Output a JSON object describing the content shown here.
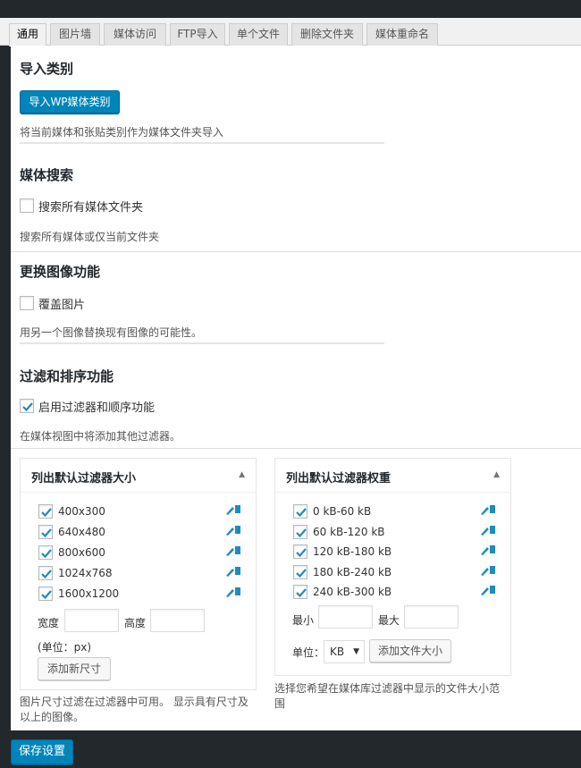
{
  "tabs": [
    "通用",
    "图片墙",
    "媒体访问",
    "FTP导入",
    "单个文件",
    "删除文件夹",
    "媒体重命名"
  ],
  "import": {
    "title": "导入类别",
    "button": "导入WP媒体类别",
    "desc": "将当前媒体和张贴类别作为媒体文件夹导入"
  },
  "search": {
    "title": "媒体搜索",
    "checkbox_label": "搜索所有媒体文件夹",
    "checked": false,
    "desc": "搜索所有媒体或仅当前文件夹"
  },
  "replace": {
    "title": "更换图像功能",
    "checkbox_label": "覆盖图片",
    "checked": false,
    "desc": "用另一个图像替换现有图像的可能性。"
  },
  "filter": {
    "title": "过滤和排序功能",
    "checkbox_label": "启用过滤器和顺序功能",
    "checked": true,
    "desc": "在媒体视图中将添加其他过滤器。"
  },
  "size_box": {
    "title": "列出默认过滤器大小",
    "items": [
      "400x300",
      "640x480",
      "800x600",
      "1024x768",
      "1600x1200"
    ],
    "width_label": "宽度",
    "height_label": "高度",
    "unit_note": "(单位：px)",
    "add_button": "添加新尺寸",
    "note_line1": "图片尺寸过滤在过滤器中可用。 显示具有尺寸及",
    "note_line2": "以上的图像。"
  },
  "weight_box": {
    "title": "列出默认过滤器权重",
    "items": [
      "0 kB-60 kB",
      "60 kB-120 kB",
      "120 kB-180 kB",
      "180 kB-240 kB",
      "240 kB-300 kB"
    ],
    "min_label": "最小",
    "max_label": "最大",
    "unit_label": "单位：",
    "unit_value": "KB",
    "add_button": "添加文件大小",
    "note_line1": "选择您希望在媒体库过滤器中显示的文件大小范",
    "note_line2": "围"
  },
  "save_button": "保存设置",
  "colors": {
    "primary": "#0085ba",
    "dark_bg": "#23282d",
    "check": "#1e8cbe"
  },
  "icons": {
    "checkbox_tick": "check-icon",
    "edit": "edit-pencil-icon",
    "collapse": "triangle-up-icon"
  }
}
